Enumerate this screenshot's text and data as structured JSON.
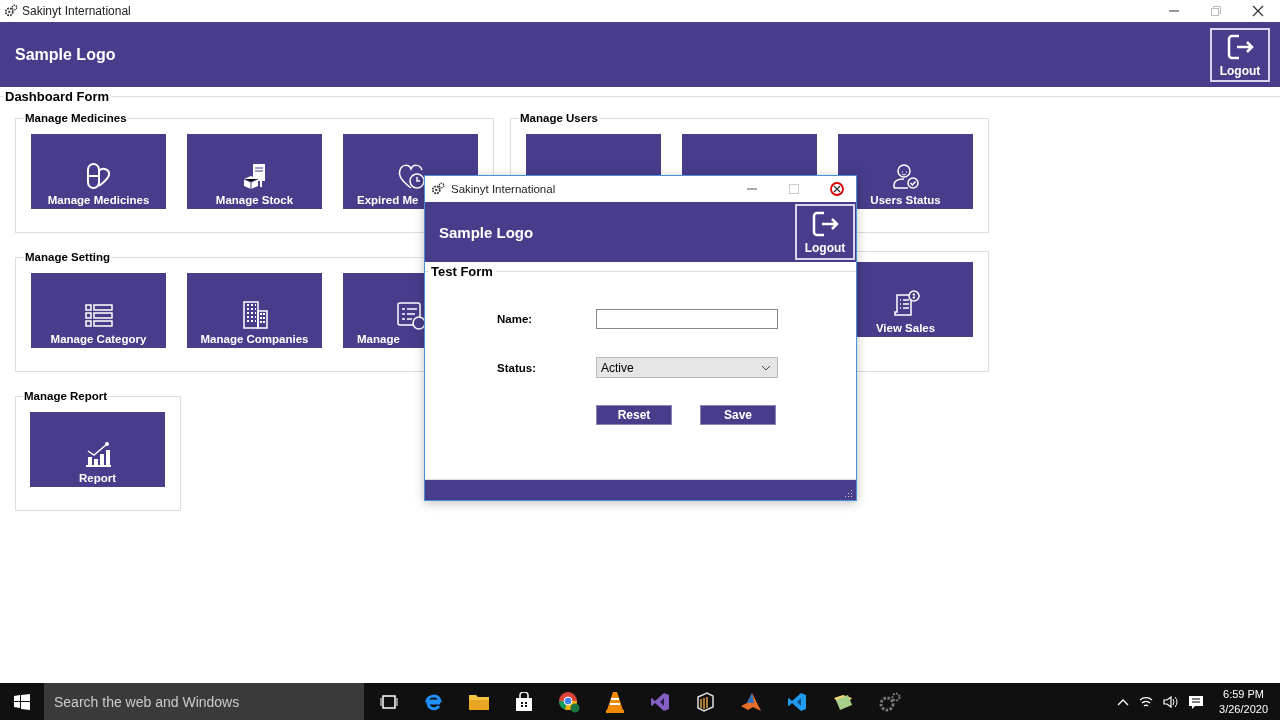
{
  "window": {
    "title": "Sakinyt International"
  },
  "header": {
    "logo": "Sample Logo",
    "logout": "Logout"
  },
  "dashboard": {
    "title": "Dashboard Form",
    "groups": [
      {
        "title": "Manage Medicines",
        "tiles": [
          {
            "kind": "pill",
            "label": "Manage Medicines"
          },
          {
            "kind": "stock",
            "label": "Manage Stock"
          },
          {
            "kind": "expired",
            "label": "Expired Me"
          }
        ]
      },
      {
        "title": "Manage Users",
        "tiles": [
          {
            "kind": "blank"
          },
          {
            "kind": "blank"
          },
          {
            "kind": "users",
            "label": "Users Status"
          }
        ]
      },
      {
        "title": "Manage Setting",
        "tiles": [
          {
            "kind": "category",
            "label": "Manage Category"
          },
          {
            "kind": "companies",
            "label": "Manage Companies"
          },
          {
            "kind": "manage",
            "label": "Manage"
          }
        ]
      },
      {
        "tiles": [
          {
            "kind": "sales",
            "label": "View Sales"
          }
        ]
      },
      {
        "title": "Manage Report",
        "tiles": [
          {
            "kind": "report",
            "label": "Report"
          }
        ]
      }
    ]
  },
  "dialog": {
    "title": "Sakinyt International",
    "close_highlighted": true,
    "logo": "Sample Logo",
    "logout": "Logout",
    "form_title": "Test Form",
    "fields": [
      {
        "kind": "text",
        "label": "Name:"
      },
      {
        "kind": "select",
        "label": "Status:",
        "value": "Active"
      }
    ],
    "buttons": [
      "Reset",
      "Save"
    ]
  },
  "taskbar": {
    "search_placeholder": "Search the web and Windows",
    "time": "6:59 PM",
    "date": "3/26/2020"
  }
}
